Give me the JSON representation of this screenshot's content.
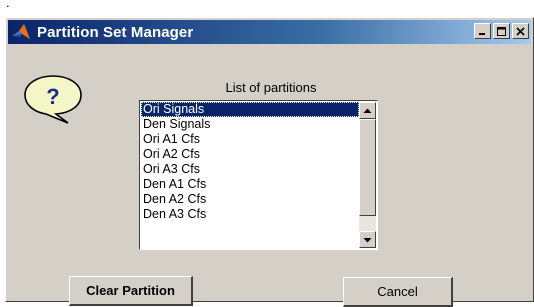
{
  "page": {
    "bullet": "."
  },
  "window": {
    "title": "Partition Set Manager",
    "title_icon": "matlab-logo-icon",
    "controls": [
      "minimize-icon",
      "maximize-icon",
      "close-icon"
    ]
  },
  "help": {
    "icon": "question-bubble-icon",
    "glyph": "?"
  },
  "list": {
    "label": "List of partitions",
    "items": [
      {
        "label": "Ori Signals",
        "selected": true
      },
      {
        "label": "Den Signals",
        "selected": false
      },
      {
        "label": "Ori A1 Cfs",
        "selected": false
      },
      {
        "label": "Ori A2 Cfs",
        "selected": false
      },
      {
        "label": "Ori A3 Cfs",
        "selected": false
      },
      {
        "label": "Den A1 Cfs",
        "selected": false
      },
      {
        "label": "Den A2 Cfs",
        "selected": false
      },
      {
        "label": "Den A3 Cfs",
        "selected": false
      }
    ]
  },
  "buttons": {
    "clear_label": "Clear Partition",
    "cancel_label": "Cancel"
  },
  "colors": {
    "titlebar_start": "#0a246a",
    "titlebar_end": "#a6caf0",
    "face": "#d4d0c8",
    "selection": "#0a246a",
    "bubble_fill": "#f4f6c8"
  }
}
